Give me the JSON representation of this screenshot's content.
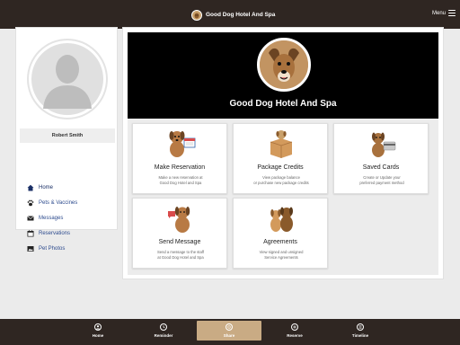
{
  "header": {
    "title": "Good Dog Hotel And Spa",
    "menu_label": "Menu",
    "logo_icon": "dog-logo-icon",
    "menu_icon": "hamburger-icon"
  },
  "sidebar": {
    "user_name": "Robert Smith",
    "avatar_icon": "user-silhouette-icon",
    "items": [
      {
        "label": "Home",
        "icon": "home-icon"
      },
      {
        "label": "Pets & Vaccines",
        "icon": "paw-icon"
      },
      {
        "label": "Messages",
        "icon": "envelope-icon"
      },
      {
        "label": "Reservations",
        "icon": "calendar-icon"
      },
      {
        "label": "Pet Photos",
        "icon": "photo-icon"
      }
    ]
  },
  "hero": {
    "title": "Good Dog Hotel And Spa"
  },
  "cards": [
    {
      "title": "Make Reservation",
      "desc1": "Make a new reservation at",
      "desc2": "Good Dog Hotel and Spa"
    },
    {
      "title": "Package Credits",
      "desc1": "View package balance",
      "desc2": "or purchase new package credits"
    },
    {
      "title": "Saved Cards",
      "desc1": "Create or Update your",
      "desc2": "preferred payment method"
    },
    {
      "title": "Send Message",
      "desc1": "Send a message to the staff",
      "desc2": "at Good Dog Hotel and Spa"
    },
    {
      "title": "Agreements",
      "desc1": "View signed and unsigned",
      "desc2": "Service Agreements"
    }
  ],
  "tabbar": {
    "items": [
      {
        "label": "Home",
        "icon": "person-circle-icon"
      },
      {
        "label": "Reminder",
        "icon": "clock-icon"
      },
      {
        "label": "Share",
        "icon": "share-icon"
      },
      {
        "label": "Reserve",
        "icon": "plus-circle-icon"
      },
      {
        "label": "Timeline",
        "icon": "timeline-icon"
      }
    ],
    "active": "Share"
  },
  "colors": {
    "topbar": "#2f2622",
    "accent": "#c9ab84",
    "nav_link": "#2d4b8e"
  }
}
